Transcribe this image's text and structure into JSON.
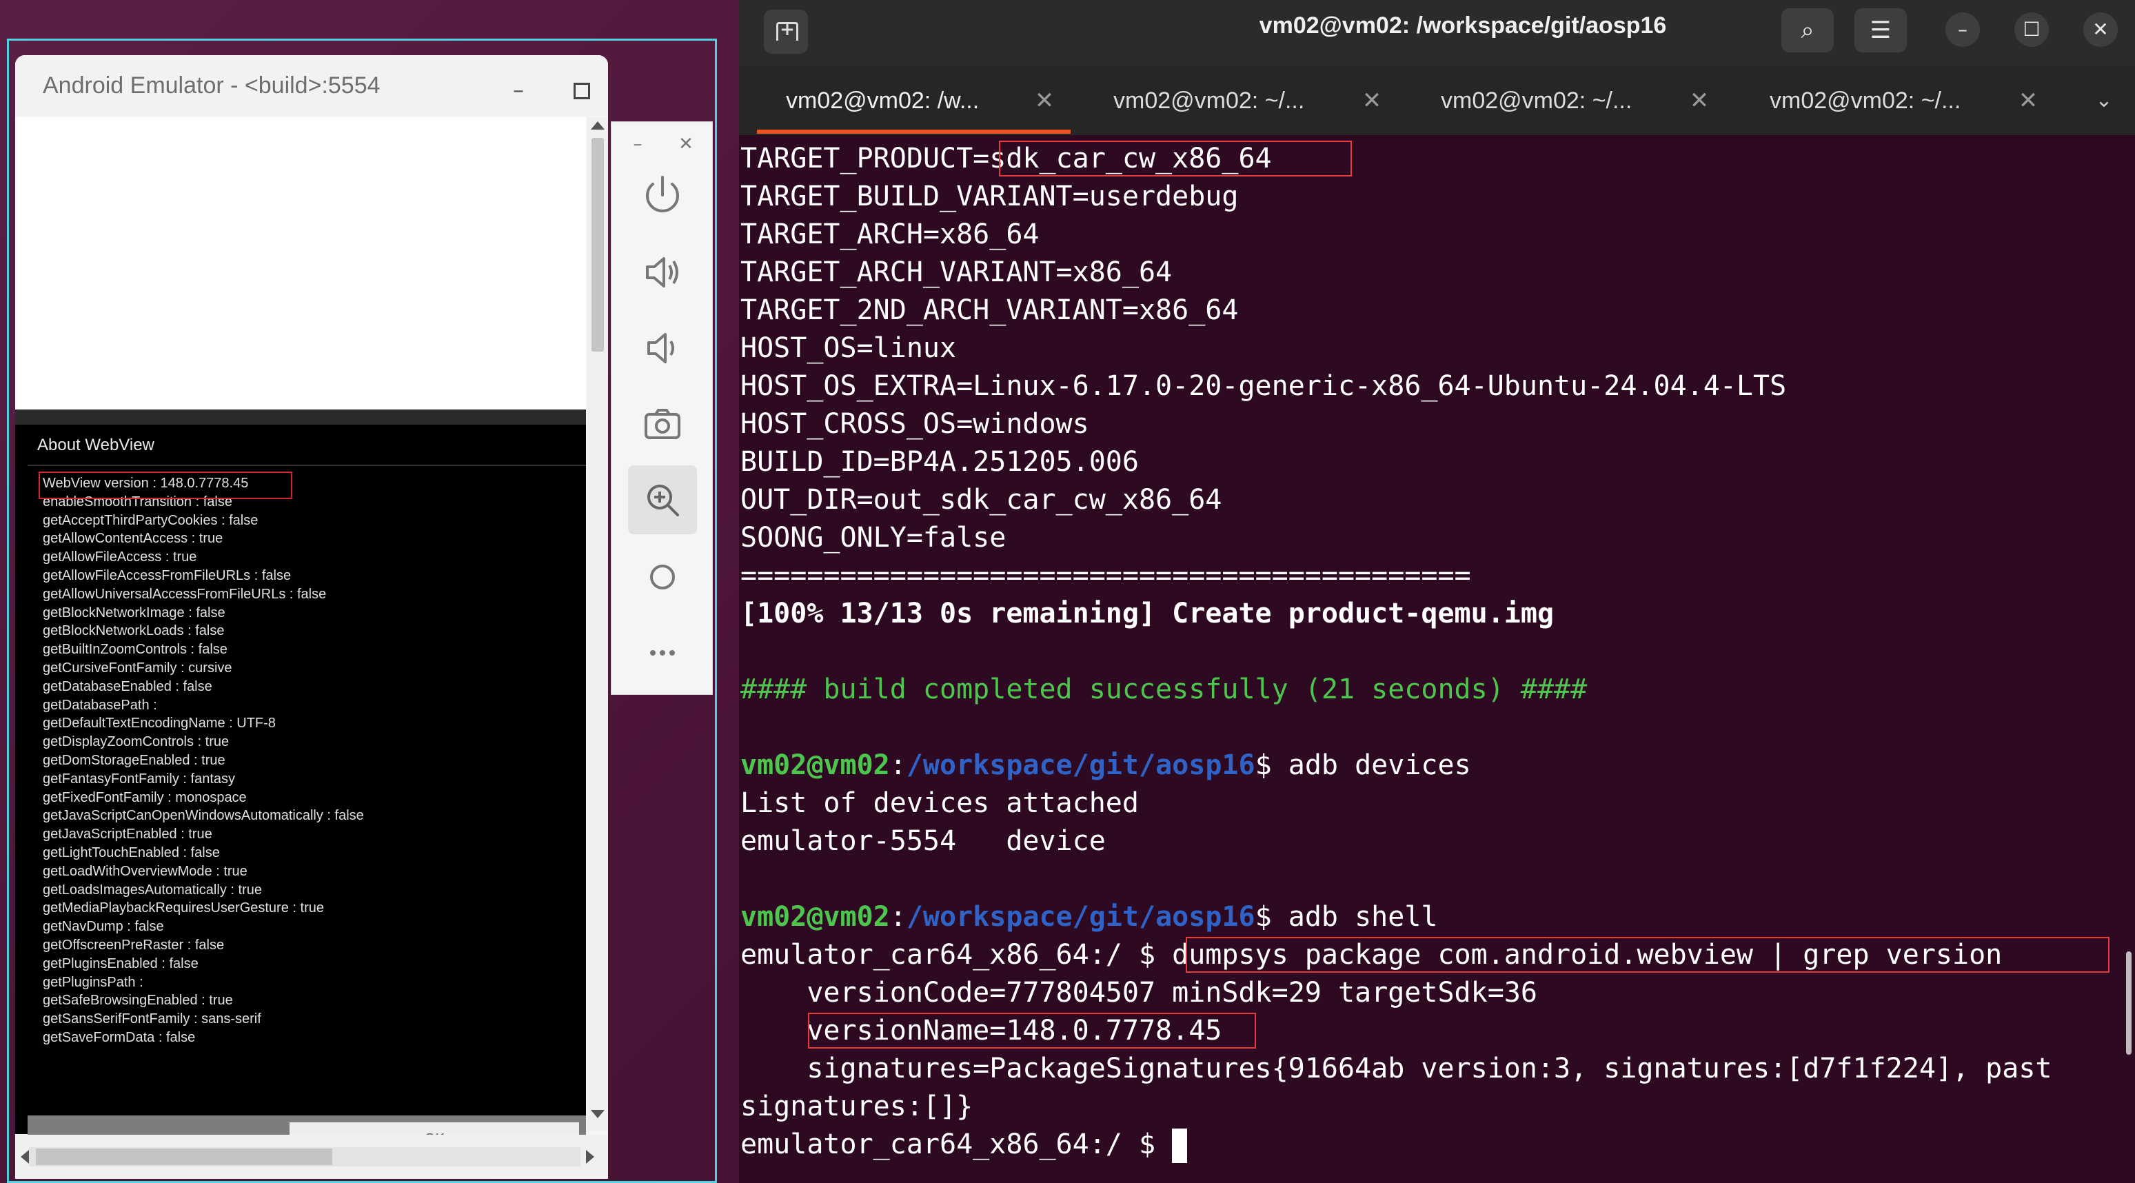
{
  "emulator": {
    "window_title": "Android Emulator - <build>:5554",
    "about": {
      "title": "About WebView",
      "ok_label": "OK",
      "properties": [
        "WebView version : 148.0.7778.45",
        "enableSmoothTransition : false",
        "getAcceptThirdPartyCookies : false",
        "getAllowContentAccess : true",
        "getAllowFileAccess : true",
        "getAllowFileAccessFromFileURLs : false",
        "getAllowUniversalAccessFromFileURLs : false",
        "getBlockNetworkImage : false",
        "getBlockNetworkLoads : false",
        "getBuiltInZoomControls : false",
        "getCursiveFontFamily : cursive",
        "getDatabaseEnabled : false",
        "getDatabasePath :",
        "getDefaultTextEncodingName : UTF-8",
        "getDisplayZoomControls : true",
        "getDomStorageEnabled : true",
        "getFantasyFontFamily : fantasy",
        "getFixedFontFamily : monospace",
        "getJavaScriptCanOpenWindowsAutomatically : false",
        "getJavaScriptEnabled : true",
        "getLightTouchEnabled : false",
        "getLoadWithOverviewMode : true",
        "getLoadsImagesAutomatically : true",
        "getMediaPlaybackRequiresUserGesture : true",
        "getNavDump : false",
        "getOffscreenPreRaster : false",
        "getPluginsEnabled : false",
        "getPluginsPath :",
        "getSafeBrowsingEnabled : true",
        "getSansSerifFontFamily : sans-serif",
        "getSaveFormData : false"
      ]
    },
    "toolbar_icons": [
      "power-icon",
      "volume-up-icon",
      "volume-down-icon",
      "camera-icon",
      "zoom-icon",
      "home-icon",
      "more-icon"
    ]
  },
  "terminal": {
    "window_title": "vm02@vm02: /workspace/git/aosp16",
    "tabs": [
      {
        "label": "vm02@vm02: /w..."
      },
      {
        "label": "vm02@vm02: ~/..."
      },
      {
        "label": "vm02@vm02: ~/..."
      },
      {
        "label": "vm02@vm02: ~/..."
      }
    ],
    "prompt_user": "vm02@vm02",
    "prompt_path": "/workspace/git/aosp16",
    "lines": {
      "target_product_key": "TARGET_PRODUCT=",
      "target_product_val": "sdk_car_cw_x86_64",
      "build_variant": "TARGET_BUILD_VARIANT=userdebug",
      "arch": "TARGET_ARCH=x86_64",
      "arch_variant": "TARGET_ARCH_VARIANT=x86_64",
      "arch2_variant": "TARGET_2ND_ARCH_VARIANT=x86_64",
      "host_os": "HOST_OS=linux",
      "host_os_extra": "HOST_OS_EXTRA=Linux-6.17.0-20-generic-x86_64-Ubuntu-24.04.4-LTS",
      "host_cross_os": "HOST_CROSS_OS=windows",
      "build_id": "BUILD_ID=BP4A.251205.006",
      "out_dir": "OUT_DIR=out_sdk_car_cw_x86_64",
      "soong_only": "SOONG_ONLY=false",
      "separator": "============================================",
      "progress": "[100% 13/13 0s remaining] Create product-qemu.img",
      "build_done": "#### build completed successfully (21 seconds) ####",
      "cmd_devices": "adb devices",
      "devices_header": "List of devices attached",
      "device_row": "emulator-5554   device",
      "cmd_shell": "adb shell",
      "shell_prompt": "emulator_car64_x86_64:/ $ ",
      "dumpsys_cmd": "dumpsys package com.android.webview | grep version",
      "version_code": "    versionCode=777804507 minSdk=29 targetSdk=36",
      "version_name_indent": "    ",
      "version_name": "versionName=148.0.7778.45",
      "signatures_1": "    signatures=PackageSignatures{91664ab version:3, signatures:[d7f1f224], past",
      "signatures_2": "signatures:[]}",
      "final_prompt": "emulator_car64_x86_64:/ $ "
    }
  }
}
